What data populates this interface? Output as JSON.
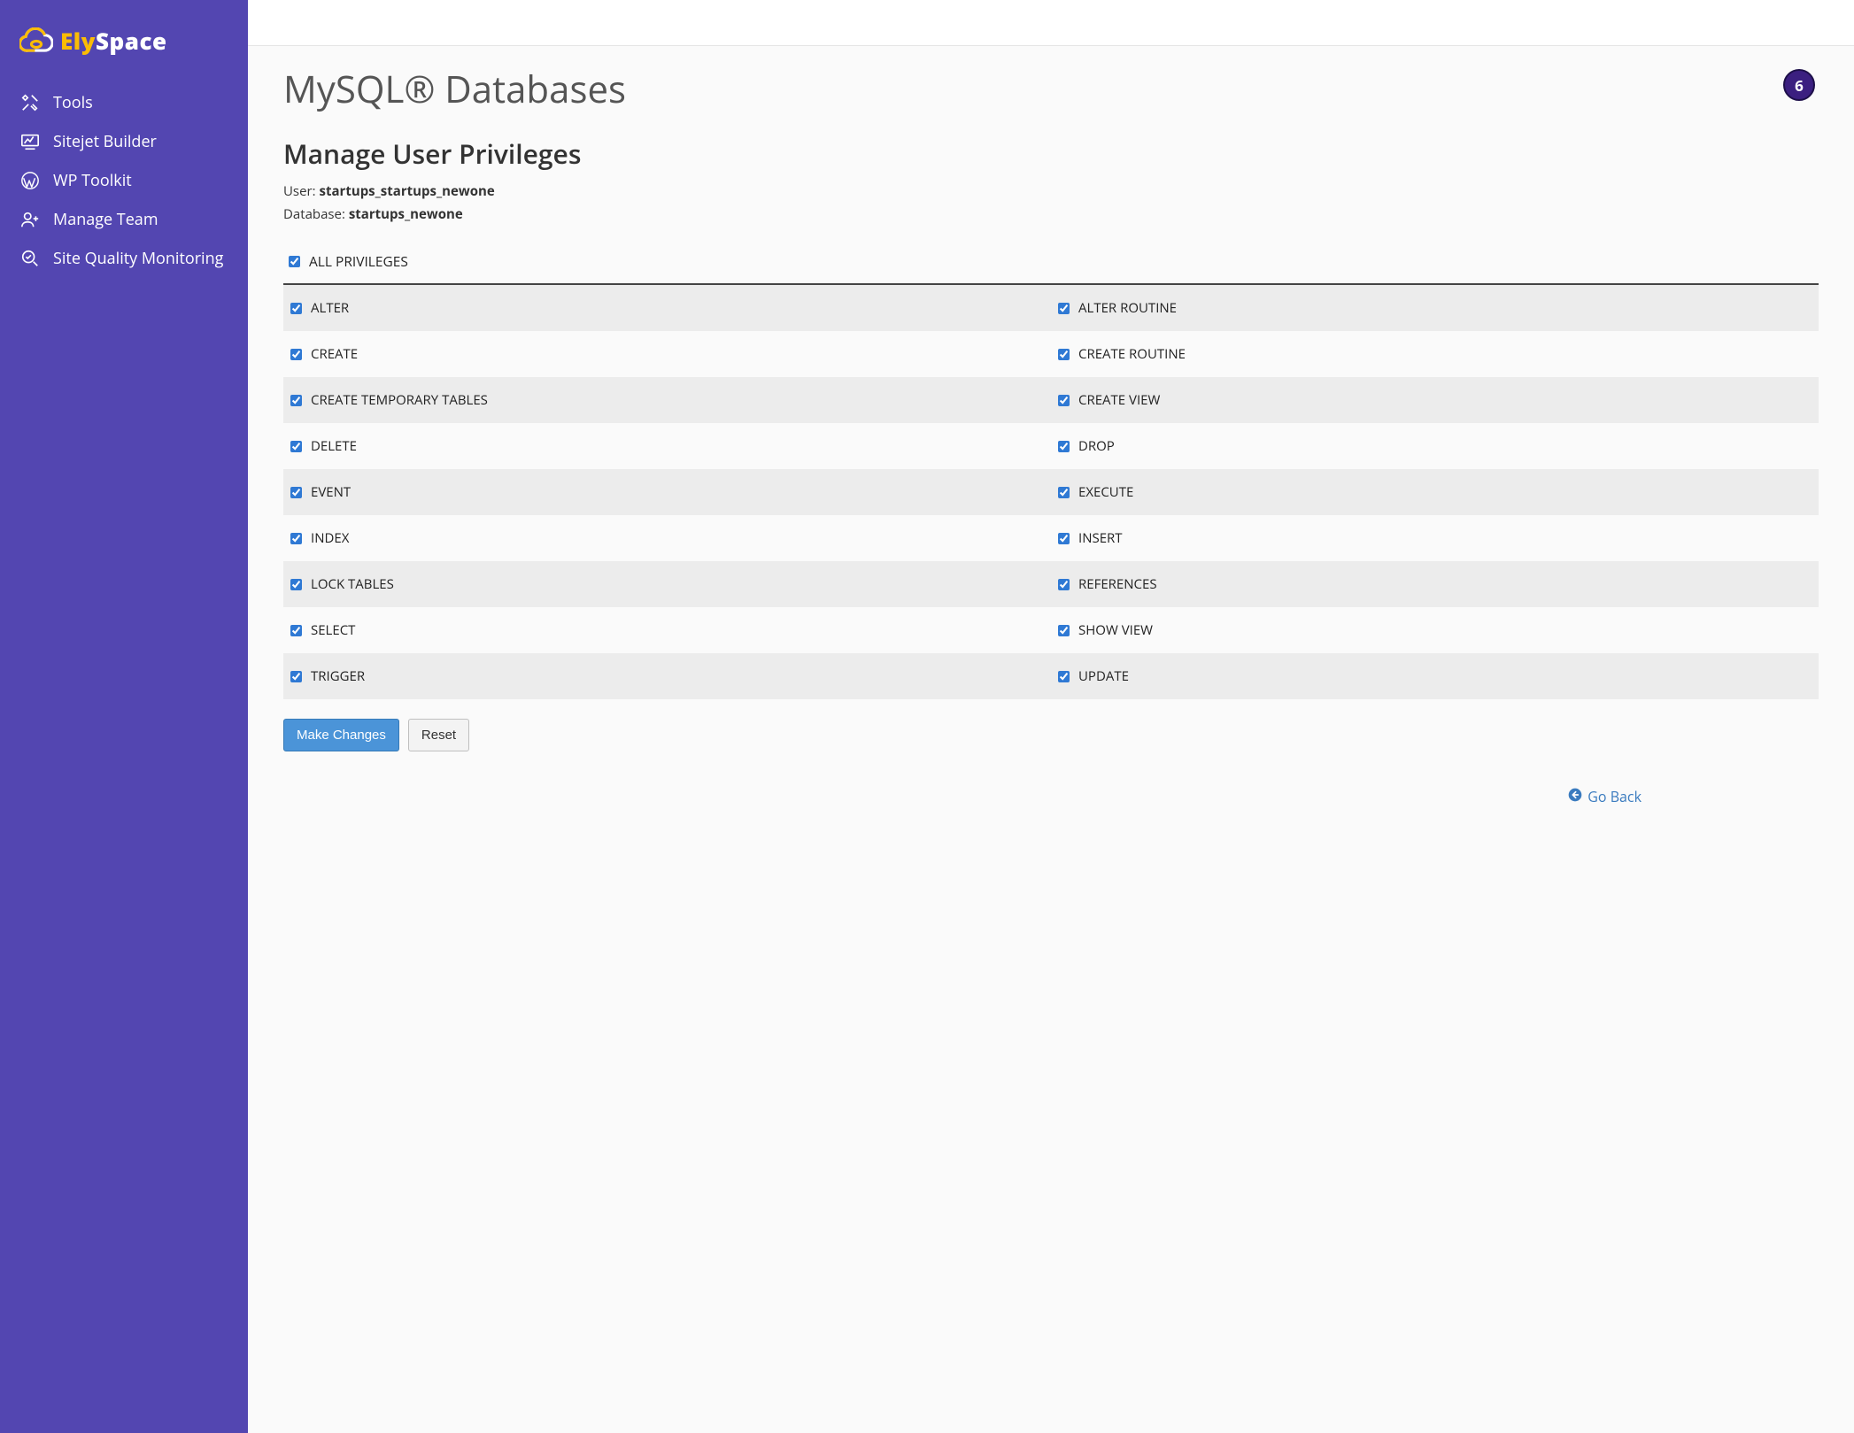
{
  "brand": {
    "name_part1": "Ely",
    "name_part2": "Space"
  },
  "sidebar": {
    "items": [
      {
        "label": "Tools"
      },
      {
        "label": "Sitejet Builder"
      },
      {
        "label": "WP Toolkit"
      },
      {
        "label": "Manage Team"
      },
      {
        "label": "Site Quality Monitoring"
      }
    ]
  },
  "header": {
    "badge_count": "6"
  },
  "page": {
    "title": "MySQL® Databases",
    "section_title": "Manage User Privileges",
    "user_label": "User: ",
    "user_value": "startups_startups_newone",
    "database_label": "Database: ",
    "database_value": "startups_newone"
  },
  "privileges": {
    "all_label": "ALL PRIVILEGES",
    "all_checked": true,
    "rows": [
      {
        "left": "ALTER",
        "right": "ALTER ROUTINE"
      },
      {
        "left": "CREATE",
        "right": "CREATE ROUTINE"
      },
      {
        "left": "CREATE TEMPORARY TABLES",
        "right": "CREATE VIEW"
      },
      {
        "left": "DELETE",
        "right": "DROP"
      },
      {
        "left": "EVENT",
        "right": "EXECUTE"
      },
      {
        "left": "INDEX",
        "right": "INSERT"
      },
      {
        "left": "LOCK TABLES",
        "right": "REFERENCES"
      },
      {
        "left": "SELECT",
        "right": "SHOW VIEW"
      },
      {
        "left": "TRIGGER",
        "right": "UPDATE"
      }
    ]
  },
  "actions": {
    "primary": "Make Changes",
    "reset": "Reset",
    "go_back": "Go Back"
  }
}
